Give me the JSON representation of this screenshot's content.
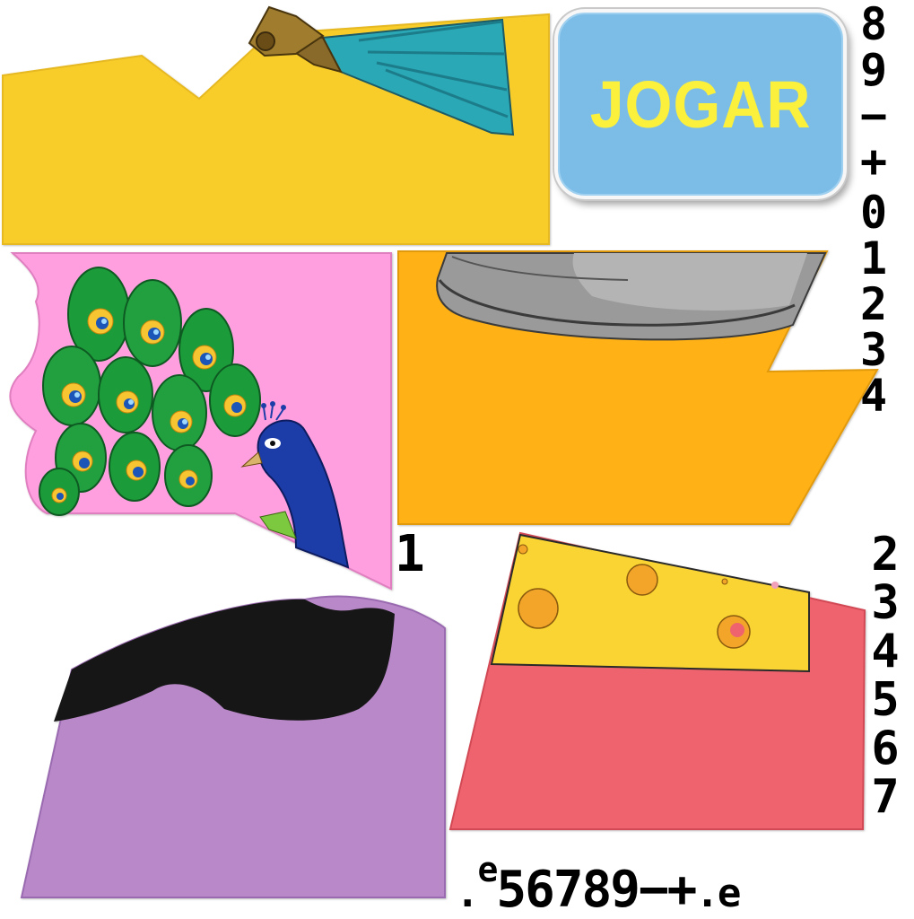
{
  "game": {
    "play_button_label": "JOGAR"
  },
  "puzzle_pieces": [
    {
      "id": "top-left",
      "motif": "yellow-fan"
    },
    {
      "id": "middle-left",
      "motif": "peacock"
    },
    {
      "id": "middle-right",
      "motif": "silver-pot"
    },
    {
      "id": "bottom-left",
      "motif": "purple-figure"
    },
    {
      "id": "bottom-right",
      "motif": "cheese"
    }
  ],
  "glyphs": {
    "right_column_top": [
      "8",
      "9",
      "−",
      "+",
      "0",
      "1",
      "2",
      "3",
      "4"
    ],
    "right_column_bottom": [
      "2",
      "3",
      "4",
      "5",
      "6",
      "7"
    ],
    "single_digit": "1",
    "bottom_row": {
      "lead_dot": ".",
      "lead_e": "e",
      "main": "56789−+",
      "trail_dot": ".",
      "trail_e": "e"
    }
  },
  "colors": {
    "yellow": "#f8cd2c",
    "pink": "#ff9fdf",
    "orange": "#ffb117",
    "purple": "#b988c9",
    "red": "#ee646e",
    "cheese": "#fad432",
    "button": "#7cbde8",
    "button_text": "#fbf13c"
  }
}
